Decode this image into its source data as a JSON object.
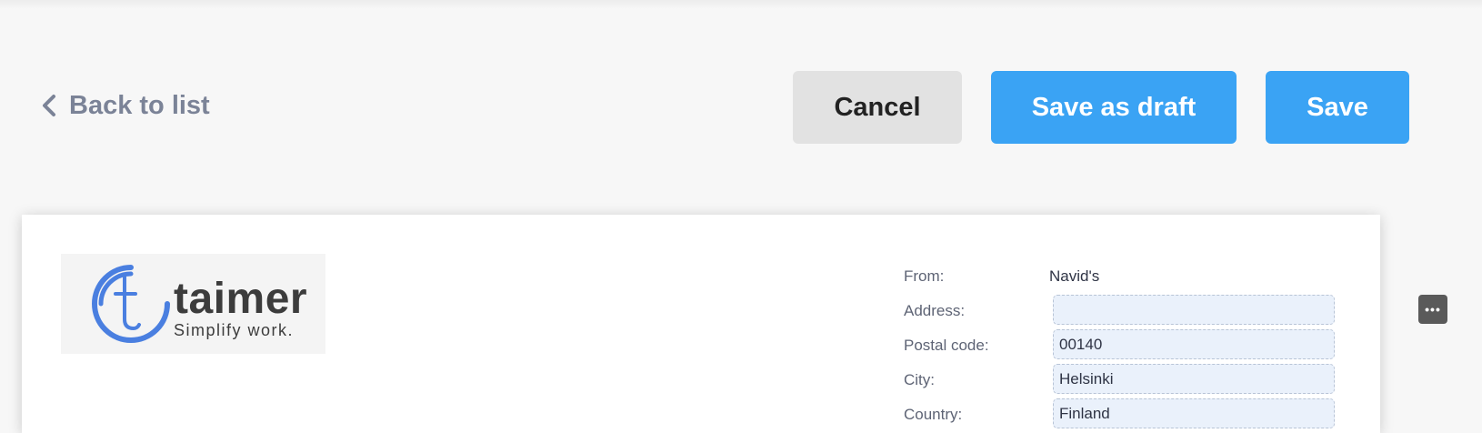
{
  "header": {
    "back_label": "Back to list",
    "cancel_label": "Cancel",
    "save_draft_label": "Save as draft",
    "save_label": "Save"
  },
  "logo": {
    "name": "taimer",
    "tagline": "Simplify work."
  },
  "form": {
    "from_label": "From:",
    "from_value": "Navid's",
    "address_label": "Address:",
    "address_value": "",
    "postal_label": "Postal code:",
    "postal_value": "00140",
    "city_label": "City:",
    "city_value": "Helsinki",
    "country_label": "Country:",
    "country_value": "Finland"
  },
  "colors": {
    "accent": "#3aa3f4",
    "field_bg": "#eaf1fb",
    "back_link": "#7b8397",
    "logo_blue": "#4a7fe0"
  },
  "icons": {
    "back": "chevron-left-icon",
    "more": "more-options-icon"
  }
}
